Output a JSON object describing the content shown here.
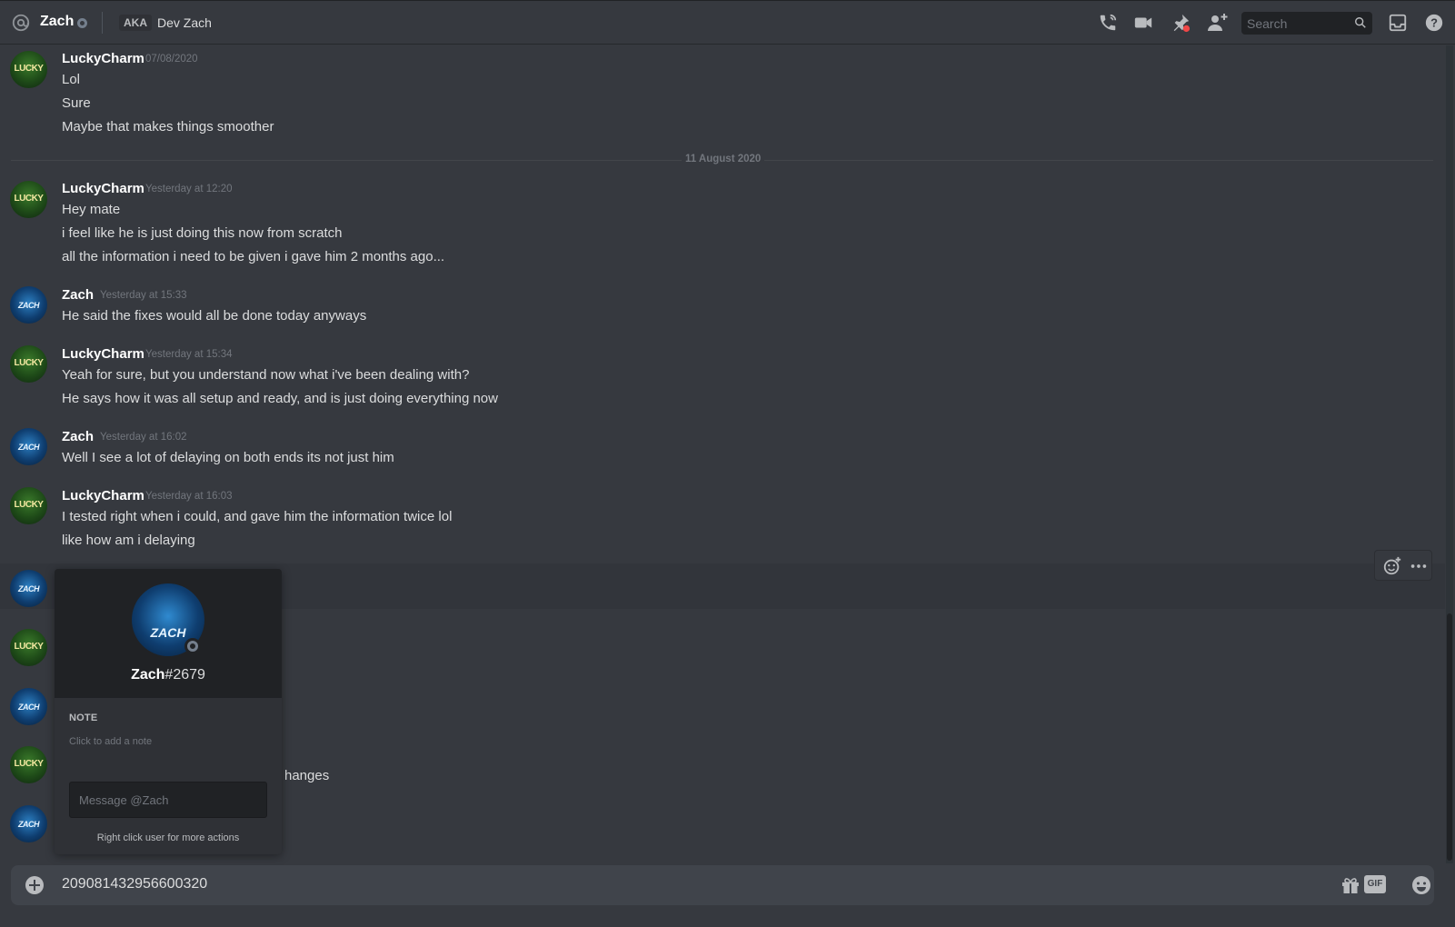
{
  "header": {
    "icon": "at-icon",
    "user_name": "Zach",
    "aka_label": "AKA",
    "aka_name": "Dev Zach",
    "icons": [
      "start-voice-call-icon",
      "start-video-call-icon",
      "pinned-messages-icon",
      "add-friends-to-dm-icon",
      "inbox-icon",
      "help-icon"
    ],
    "search_placeholder": "Search"
  },
  "messages": [
    {
      "author": "LuckyCharm",
      "avatar": "LUCKY",
      "timestamp": "07/08/2020",
      "lines": [
        "Lol",
        "Sure",
        "Maybe that makes things smoother"
      ]
    },
    {
      "author": "LuckyCharm",
      "avatar": "LUCKY",
      "timestamp": "Yesterday at 12:20",
      "lines": [
        "Hey mate",
        "i feel like he is just doing this now from scratch",
        "all the information i need to be given i gave him 2 months ago..."
      ]
    },
    {
      "author": "Zach",
      "avatar": "ZACH",
      "timestamp": "Yesterday at 15:33",
      "lines": [
        "He said the fixes would all be done today anyways"
      ]
    },
    {
      "author": "LuckyCharm",
      "avatar": "LUCKY",
      "timestamp": "Yesterday at 15:34",
      "lines": [
        "Yeah for sure, but you understand now what i've been dealing with?",
        "He says how it was all setup and ready, and is just doing everything now"
      ]
    },
    {
      "author": "Zach",
      "avatar": "ZACH",
      "timestamp": "Yesterday at 16:02",
      "lines": [
        "Well I see a lot of delaying on both ends its not just him"
      ]
    },
    {
      "author": "LuckyCharm",
      "avatar": "LUCKY",
      "timestamp": "Yesterday at 16:03",
      "lines": [
        "I tested right when i could, and gave him the information twice lol",
        "like how am i delaying"
      ]
    }
  ],
  "date_divider": "11 August 2020",
  "hidden_row_fragment": "hanges",
  "popout": {
    "username": "Zach",
    "discriminator": "#2679",
    "avatar_text": "ZACH",
    "note_label": "NOTE",
    "note_placeholder": "Click to add a note",
    "message_placeholder": "Message @Zach",
    "hint": "Right click user for more actions"
  },
  "composer": {
    "value": "209081432956600320",
    "icons": [
      "add-attachment-icon",
      "gift-icon",
      "gif-icon",
      "emoji-icon"
    ],
    "gif_label": "GIF"
  },
  "hover_actions": [
    "add-reaction-icon",
    "more-options-icon"
  ],
  "colors": {
    "background": "#36393f",
    "header_divider": "#202225",
    "text_primary": "#dcddde",
    "text_muted": "#72767d",
    "status_offline": "#747f8d",
    "pin_badge_red": "#f04747"
  }
}
